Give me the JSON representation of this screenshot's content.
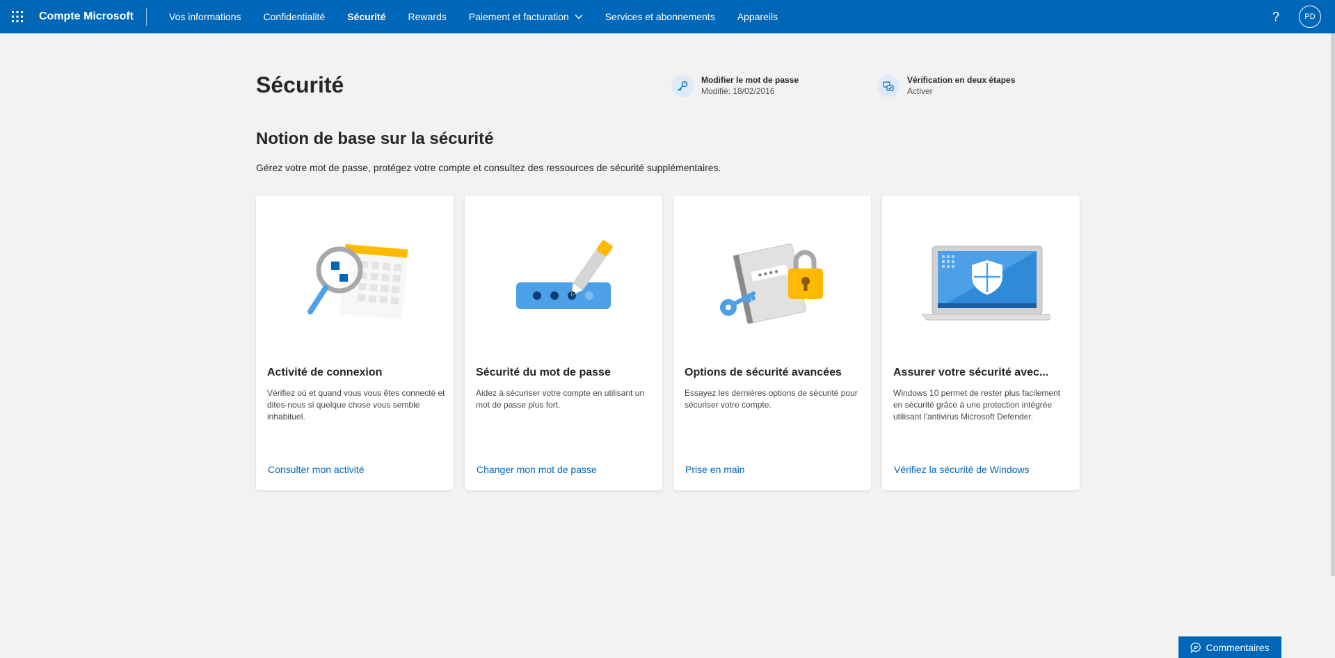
{
  "topbar": {
    "brand": "Compte Microsoft",
    "nav": [
      {
        "label": "Vos informations",
        "active": false
      },
      {
        "label": "Confidentialité",
        "active": false
      },
      {
        "label": "Sécurité",
        "active": true
      },
      {
        "label": "Rewards",
        "active": false
      },
      {
        "label": "Paiement et facturation",
        "active": false
      },
      {
        "label": "Services et abonnements",
        "active": false
      },
      {
        "label": "Appareils",
        "active": false
      }
    ],
    "help": "?",
    "avatar_initials": "PD",
    "icons": {
      "app_launcher": "waffle-icon",
      "dropdown": "chevron-down-icon",
      "help": "help-icon"
    }
  },
  "header": {
    "title": "Sécurité",
    "quick_links": [
      {
        "title": "Modifier le mot de passe",
        "subtitle": "Modifié: 18/02/2016",
        "icon": "key-icon"
      },
      {
        "title": "Vérification en deux étapes",
        "subtitle": "Activer",
        "icon": "two-step-icon"
      }
    ]
  },
  "section": {
    "title": "Notion de base sur la sécurité",
    "description": "Gérez votre mot de passe, protégez votre compte et consultez des ressources de sécurité supplémentaires."
  },
  "cards": [
    {
      "title": "Activité de connexion",
      "description": "Vérifiez où et quand vous vous êtes connecté et dites-nous si quelque chose vous semble inhabituel.",
      "link": "Consulter mon activité",
      "illustration": "magnifier-calendar-illustration"
    },
    {
      "title": "Sécurité du mot de passe",
      "description": "Aidez à sécuriser votre compte en utilisant un mot de passe plus fort.",
      "link": "Changer mon mot de passe",
      "illustration": "password-pen-illustration"
    },
    {
      "title": "Options de sécurité avancées",
      "description": "Essayez les dernières options de sécurité pour sécuriser votre compte.",
      "link": "Prise en main",
      "illustration": "notebook-lock-key-illustration"
    },
    {
      "title": "Assurer votre sécurité avec...",
      "description": "Windows 10 permet de rester plus facilement en sécurité grâce à une protection intégrée utilisant l'antivirus Microsoft Defender.",
      "link": "Vérifiez la sécurité de Windows",
      "illustration": "laptop-shield-illustration"
    }
  ],
  "feedback": {
    "label": "Commentaires",
    "icon": "chat-icon"
  },
  "colors": {
    "accent": "#0067b8",
    "background": "#f2f2f2",
    "card": "#ffffff",
    "yellow": "#ffb900"
  }
}
